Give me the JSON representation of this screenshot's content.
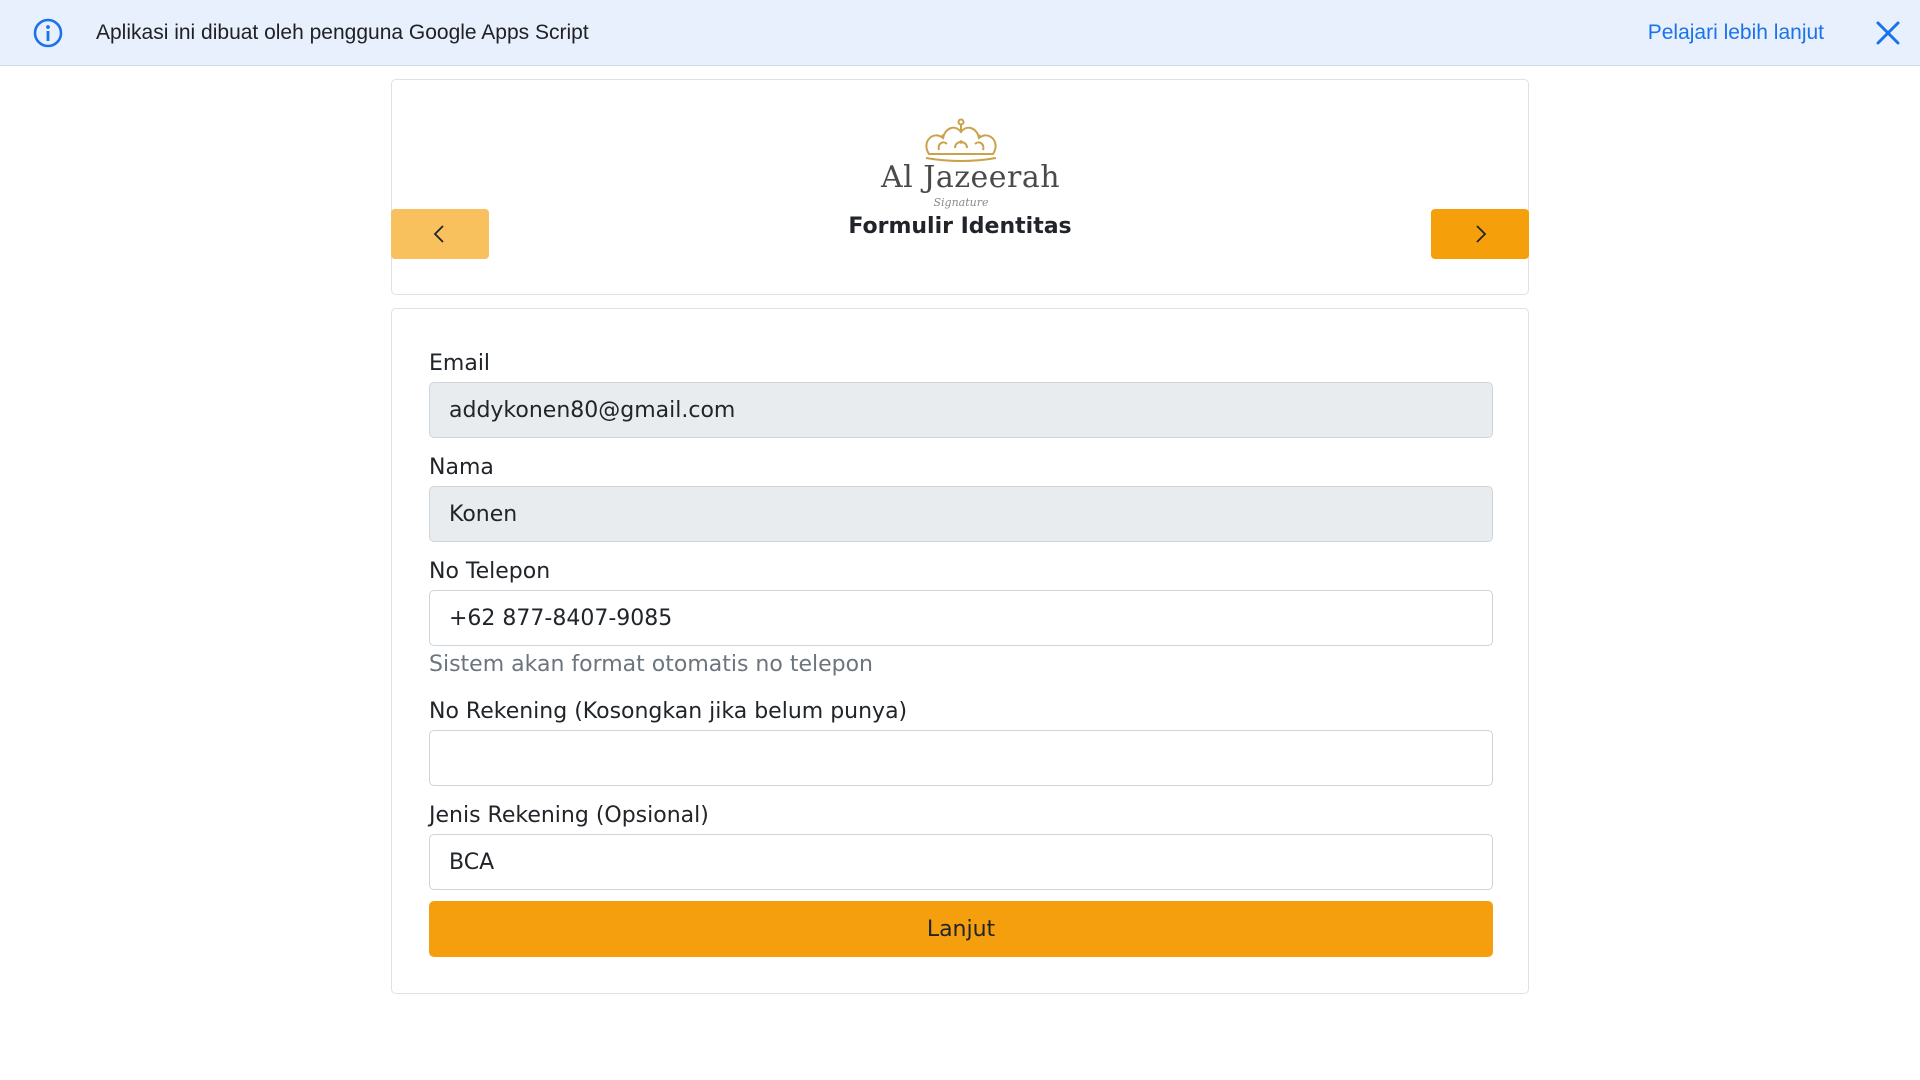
{
  "banner": {
    "icon": "info-icon",
    "text": "Aplikasi ini dibuat oleh pengguna Google Apps Script",
    "learn_more": "Pelajari lebih lanjut",
    "close_icon": "close-icon"
  },
  "header": {
    "logo": {
      "name": "Al Jazeerah",
      "signature": "Signature"
    },
    "title": "Formulir Identitas",
    "prev_icon": "chevron-left-icon",
    "next_icon": "chevron-right-icon"
  },
  "form": {
    "email": {
      "label": "Email",
      "value": "addykonen80@gmail.com"
    },
    "nama": {
      "label": "Nama",
      "value": "Konen"
    },
    "telepon": {
      "label": "No Telepon",
      "value": "+62 877-8407-9085",
      "help": "Sistem akan format otomatis no telepon"
    },
    "rekening": {
      "label": "No Rekening (Kosongkan jika belum punya)",
      "value": ""
    },
    "jenis_rekening": {
      "label": "Jenis Rekening (Opsional)",
      "value": "BCA"
    },
    "submit_label": "Lanjut"
  },
  "colors": {
    "accent": "#f59f0b",
    "accent_light": "#f8c15d",
    "banner_bg": "#e8f0fe",
    "link": "#1a73e8",
    "readonly_bg": "#e9ecef",
    "logo_gold": "#c9a24a"
  }
}
